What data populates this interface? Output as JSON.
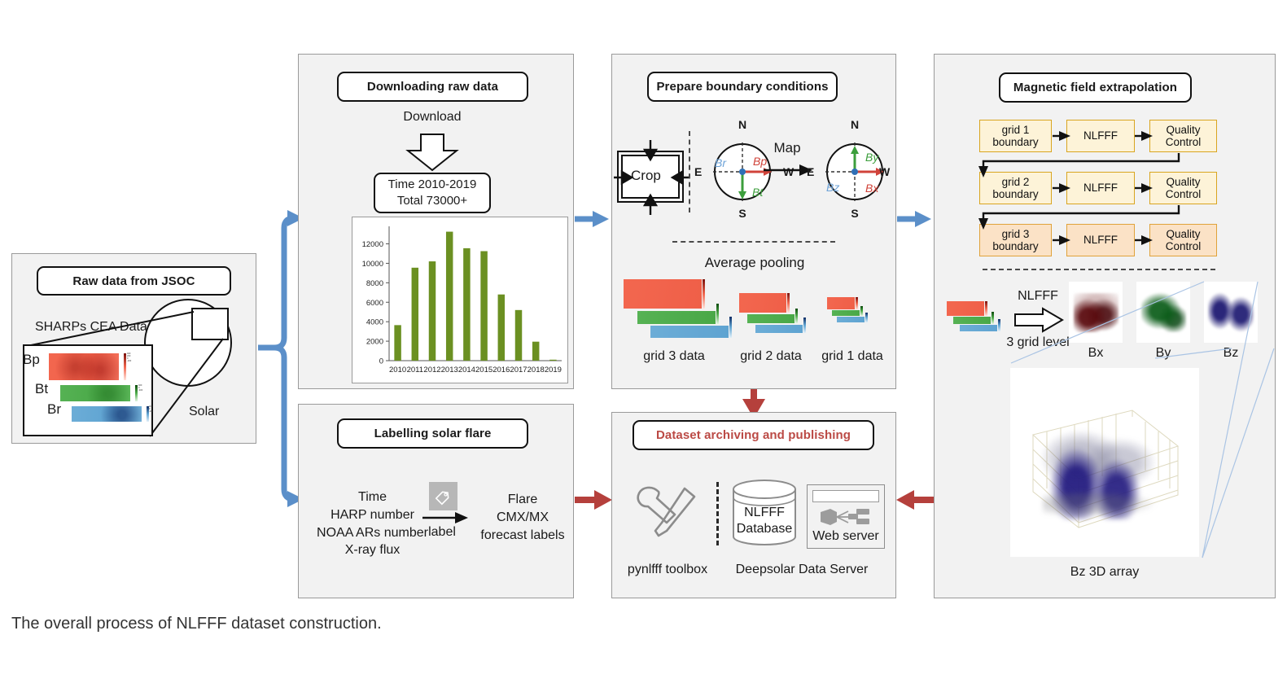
{
  "caption": "The overall process of NLFFF dataset construction.",
  "panels": {
    "raw": {
      "title": "Raw data from JSOC",
      "subtitle": "SHARPs CEA Data",
      "solar_label": "Solar",
      "components": [
        "Bp",
        "Bt",
        "Br"
      ],
      "colors": {
        "bp": "#f2644e",
        "bt": "#4ead4a",
        "br": "#63a7d4"
      }
    },
    "download": {
      "title": "Downloading raw data",
      "arrow_label": "Download",
      "summary_line1": "Time 2010-2019",
      "summary_line2": "Total  73000+"
    },
    "boundary": {
      "title": "Prepare boundary conditions",
      "crop_label": "Crop",
      "map_label": "Map",
      "compass_left": {
        "n": "N",
        "s": "S",
        "e": "E",
        "w": "W",
        "b_radial": "Br",
        "b_phi": "Bp",
        "b_theta": "Bt"
      },
      "compass_right": {
        "n": "N",
        "s": "S",
        "e": "E",
        "w": "W",
        "by": "By",
        "bx": "Bx",
        "bz": "Bz"
      },
      "pooling_label": "Average pooling",
      "grid_labels": [
        "grid 3 data",
        "grid 2 data",
        "grid 1 data"
      ]
    },
    "extrapolation": {
      "title": "Magnetic field extrapolation",
      "rows": [
        {
          "boundary": "grid 1\nboundary",
          "solver": "NLFFF",
          "qc": "Quality\nControl"
        },
        {
          "boundary": "grid 2\nboundary",
          "solver": "NLFFF",
          "qc": "Quality\nControl"
        },
        {
          "boundary": "grid 3\nboundary",
          "solver": "NLFFF",
          "qc": "Quality\nControl"
        }
      ],
      "nlfff_arrow_top": "NLFFF",
      "nlfff_arrow_bottom": "3 grid level",
      "volume_labels": [
        "Bx",
        "By",
        "Bz"
      ],
      "bz_big_label": "Bz  3D  array"
    },
    "labelling": {
      "title": "Labelling solar flare",
      "inputs": [
        "Time",
        "HARP number",
        "NOAA ARs number",
        "X-ray flux"
      ],
      "arrow_label": "label",
      "outputs": [
        "Flare",
        "CMX/MX",
        "forecast labels"
      ]
    },
    "archiving": {
      "title": "Dataset archiving and publishing",
      "toolbox_label": "pynlfff toolbox",
      "database_line1": "NLFFF",
      "database_line2": "Database",
      "webserver_label": "Web server",
      "server_group_label": "Deepsolar Data Server"
    }
  },
  "chart_data": {
    "type": "bar",
    "title": "",
    "xlabel": "",
    "ylabel": "",
    "categories": [
      "2010",
      "2011",
      "2012",
      "2013",
      "2014",
      "2015",
      "2016",
      "2017",
      "2018",
      "2019"
    ],
    "values": [
      3650,
      9550,
      10200,
      13250,
      11550,
      11250,
      6800,
      5200,
      1950,
      100
    ],
    "yticks": [
      0,
      2000,
      4000,
      6000,
      8000,
      10000,
      12000
    ],
    "ylim": [
      0,
      13800
    ],
    "grid": false,
    "legend": "none",
    "bar_color": "#6b9022"
  },
  "colors": {
    "blue_connector": "#5b8fc9",
    "red_connector": "#b5403c",
    "panel_bg": "#f2f2f2",
    "accent_red_text": "#bb4a45"
  }
}
